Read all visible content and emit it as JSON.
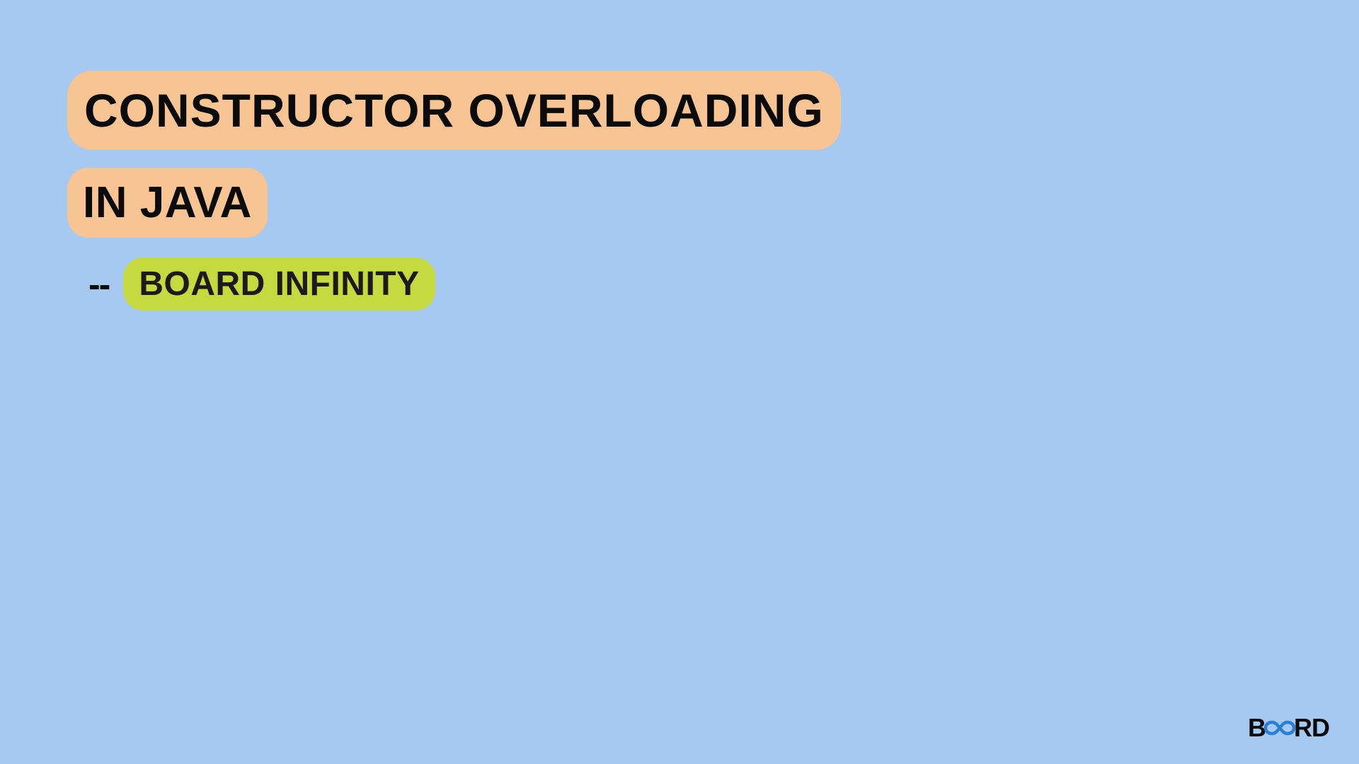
{
  "title_line_1": "CONSTRUCTOR OVERLOADING",
  "title_line_2": "IN JAVA",
  "dashes": "--",
  "subtitle": "BOARD INFINITY",
  "logo": {
    "prefix": "B",
    "suffix": "RD"
  },
  "colors": {
    "background": "#a5c9f0",
    "title_pill": "#f7c494",
    "subtitle_pill": "#c4da3e",
    "text": "#0b0b0b",
    "logo_accent": "#2a7fd4"
  }
}
